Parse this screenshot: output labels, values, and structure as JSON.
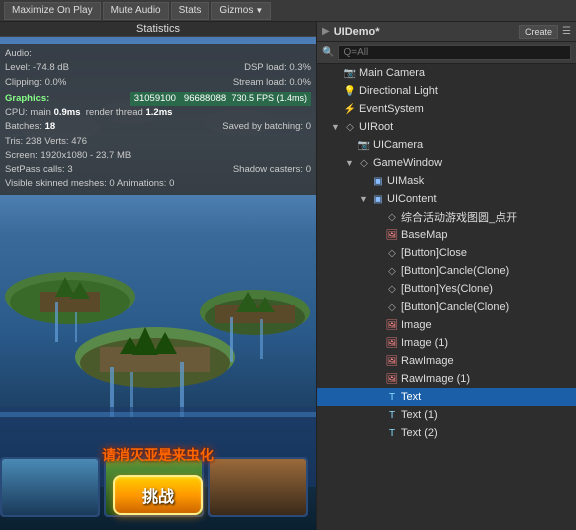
{
  "toolbar": {
    "btn1": "Maximize On Play",
    "btn2": "Mute Audio",
    "btn3": "Stats",
    "btn4": "Gizmos",
    "gizmos_arrow": "▼"
  },
  "statistics": {
    "title": "Statistics",
    "audio_label": "Audio:",
    "level_label": "Level:",
    "level_value": "-74.8 dB",
    "dsp_label": "DSP load:",
    "dsp_value": "0.3%",
    "clipping_label": "Clipping:",
    "clipping_value": "0.0%",
    "stream_label": "Stream load:",
    "stream_value": "0.0%",
    "graphics_label": "Graphics:",
    "fps_value": "730.5 FPS (1.4ms)",
    "cpu_label": "CPU: main",
    "cpu_value": "0.9ms",
    "render_label": "render thread",
    "render_value": "1.2ms",
    "batches_label": "Batches:",
    "batches_value": "18",
    "saved_label": "Saved by batching:",
    "saved_value": "0",
    "tris_label": "Tris:",
    "tris_value": "238",
    "verts_label": "Verts:",
    "verts_value": "476",
    "screen_label": "Screen:",
    "screen_value": "1920x1080 - 23.7 MB",
    "setpass_label": "SetPass calls:",
    "setpass_value": "3",
    "shadow_label": "Shadow casters:",
    "shadow_value": "0",
    "visible_label": "Visible skinned meshes:",
    "visible_value": "0",
    "anim_label": "Animations:",
    "anim_value": "0"
  },
  "fps_bar": {
    "counter1": "96688088",
    "counter2": "31059100"
  },
  "game": {
    "chinese_text": "请消灭亚是来虫化",
    "challenge_btn": "挑战"
  },
  "hierarchy": {
    "title": "UIDemo*",
    "create_btn": "Create",
    "search_placeholder": "Q=All",
    "items": [
      {
        "id": "main-camera",
        "label": "Main Camera",
        "icon": "camera",
        "indent": 1,
        "arrow": "",
        "selected": false
      },
      {
        "id": "directional-light",
        "label": "Directional Light",
        "icon": "light",
        "indent": 1,
        "arrow": "",
        "selected": false
      },
      {
        "id": "event-system",
        "label": "EventSystem",
        "icon": "event",
        "indent": 1,
        "arrow": "",
        "selected": false
      },
      {
        "id": "ui-root",
        "label": "UIRoot",
        "icon": "gameobj",
        "indent": 1,
        "arrow": "▼",
        "selected": false
      },
      {
        "id": "ui-camera",
        "label": "UICamera",
        "icon": "camera",
        "indent": 2,
        "arrow": "",
        "selected": false
      },
      {
        "id": "game-window",
        "label": "GameWindow",
        "icon": "gameobj",
        "indent": 2,
        "arrow": "▼",
        "selected": false
      },
      {
        "id": "ui-mask",
        "label": "UIMask",
        "icon": "ui",
        "indent": 3,
        "arrow": "",
        "selected": false
      },
      {
        "id": "ui-content",
        "label": "UIContent",
        "icon": "ui",
        "indent": 3,
        "arrow": "▼",
        "selected": false
      },
      {
        "id": "activity",
        "label": "综合活动游戏图圆_点开",
        "icon": "gameobj",
        "indent": 4,
        "arrow": "",
        "selected": false
      },
      {
        "id": "base-map",
        "label": "BaseMap",
        "icon": "image",
        "indent": 4,
        "arrow": "",
        "selected": false
      },
      {
        "id": "btn-close",
        "label": "[Button]Close",
        "icon": "gameobj",
        "indent": 4,
        "arrow": "",
        "selected": false
      },
      {
        "id": "btn-cancle-clone",
        "label": "[Button]Cancle(Clone)",
        "icon": "gameobj",
        "indent": 4,
        "arrow": "",
        "selected": false
      },
      {
        "id": "btn-yes-clone",
        "label": "[Button]Yes(Clone)",
        "icon": "gameobj",
        "indent": 4,
        "arrow": "",
        "selected": false
      },
      {
        "id": "btn-cancle-clone2",
        "label": "[Button]Cancle(Clone)",
        "icon": "gameobj",
        "indent": 4,
        "arrow": "",
        "selected": false
      },
      {
        "id": "image",
        "label": "Image",
        "icon": "image",
        "indent": 4,
        "arrow": "",
        "selected": false
      },
      {
        "id": "image-1",
        "label": "Image (1)",
        "icon": "image",
        "indent": 4,
        "arrow": "",
        "selected": false
      },
      {
        "id": "raw-image",
        "label": "RawImage",
        "icon": "image",
        "indent": 4,
        "arrow": "",
        "selected": false
      },
      {
        "id": "raw-image-1",
        "label": "RawImage (1)",
        "icon": "image",
        "indent": 4,
        "arrow": "",
        "selected": false
      },
      {
        "id": "text",
        "label": "Text",
        "icon": "text",
        "indent": 4,
        "arrow": "",
        "selected": true
      },
      {
        "id": "text-1",
        "label": "Text (1)",
        "icon": "text",
        "indent": 4,
        "arrow": "",
        "selected": false
      },
      {
        "id": "text-2",
        "label": "Text (2)",
        "icon": "text",
        "indent": 4,
        "arrow": "",
        "selected": false
      }
    ]
  }
}
